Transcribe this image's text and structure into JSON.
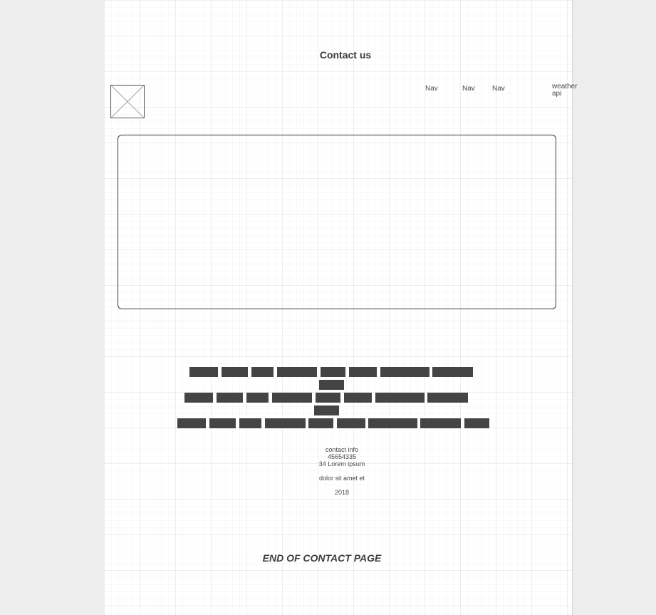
{
  "header": {
    "title": "Contact us",
    "nav_items": [
      "Nav",
      "Nav",
      "Nav"
    ],
    "weather_label": "weather api"
  },
  "hero": {
    "description": ""
  },
  "placeholder_text_rows": 5,
  "contact": {
    "heading": "contact info",
    "phone": "45654335",
    "address": "34 Lorem ipsum",
    "extra": "dolor sit amet et",
    "year": "2018"
  },
  "footer": {
    "end_label": "END OF CONTACT PAGE"
  },
  "colors": {
    "text_block": "#444444",
    "border": "#3c3c3c",
    "canvas_bg": "#ffffff",
    "outer_bg": "#ededed"
  }
}
